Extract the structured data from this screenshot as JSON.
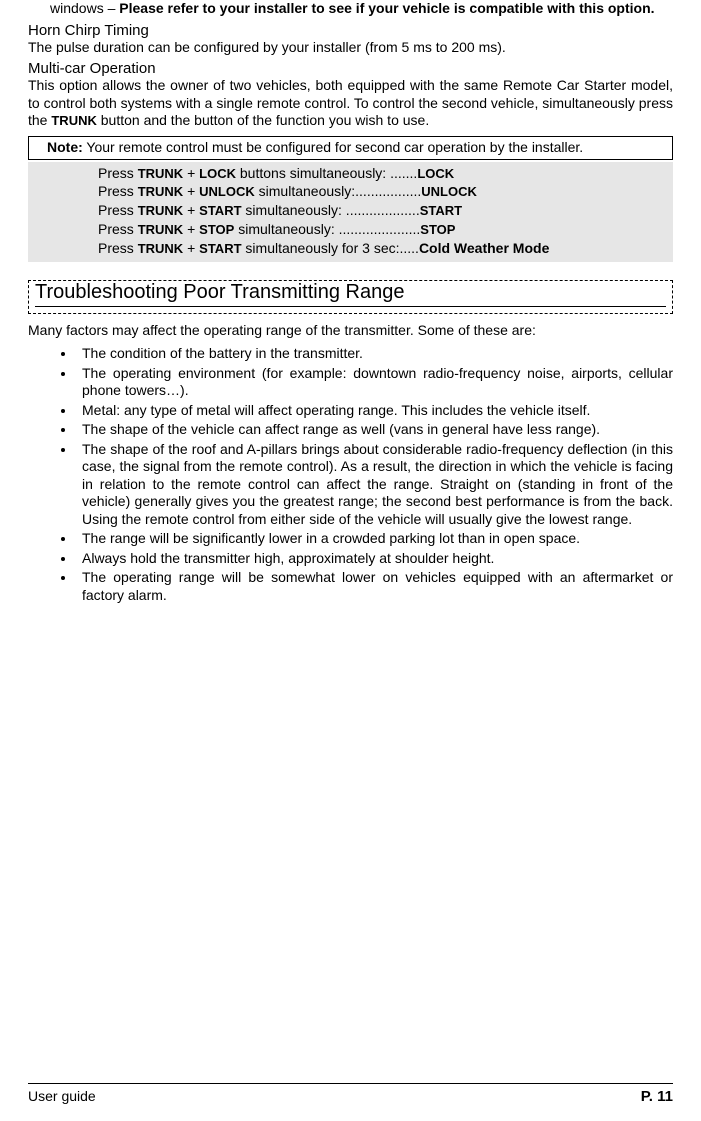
{
  "intro": {
    "windows_pre": "windows – ",
    "windows_bold": "Please refer to your installer to see if your vehicle is compatible with this option."
  },
  "horn": {
    "heading": "Horn Chirp Timing",
    "text": "The pulse duration can be configured by your installer (from 5 ms to 200 ms)."
  },
  "multicar": {
    "heading": "Multi-car Operation",
    "text_a": "This option allows the owner of two vehicles, both equipped with the same Remote Car Starter model, to control both systems with a single remote control. To control the second vehicle, simultaneously press the ",
    "text_trunk": "TRUNK",
    "text_b": " button and the button of the function you wish to use."
  },
  "note": {
    "label": "Note:",
    "text": " Your remote control must be configured for second car operation by the installer."
  },
  "combo": {
    "press": "Press ",
    "trunk": "TRUNK",
    "plus": " + ",
    "lock": "LOCK",
    "unlock": "UNLOCK",
    "start": "START",
    "stop": "STOP",
    "cwm": "Cold Weather Mode",
    "rows": [
      {
        "btn": "LOCK",
        "mid": " buttons simultaneously: .......",
        "result": "LOCK"
      },
      {
        "btn": "UNLOCK",
        "mid": " simultaneously:.................",
        "result": "UNLOCK"
      },
      {
        "btn": "START",
        "mid": " simultaneously: ...................",
        "result": "START"
      },
      {
        "btn": "STOP",
        "mid": " simultaneously: .....................",
        "result": "STOP"
      },
      {
        "btn": "START",
        "mid": " simultaneously for 3 sec:.....",
        "result": "Cold Weather Mode"
      }
    ]
  },
  "troubleshoot": {
    "heading": "Troubleshooting Poor Transmitting Range",
    "intro": "Many factors may affect the operating range of the transmitter.  Some of these are:",
    "bullets": [
      "The condition of the battery in the transmitter.",
      "The operating environment (for example: downtown radio-frequency noise, airports, cellular phone towers…).",
      "Metal: any type of metal will affect operating range. This includes the vehicle itself.",
      "The shape of the vehicle can affect range as well (vans in general have less range).",
      "The shape of the roof and A-pillars brings about considerable radio-frequency deflection (in this case, the signal from the remote control). As a result, the direction in which the vehicle is facing in relation to the remote control can affect the range. Straight on (standing in front of the vehicle) generally gives you the greatest range; the second best performance is from the back. Using the remote control from either side of the vehicle will usually give the lowest range.",
      "The range will be significantly lower in a crowded parking lot than in open space.",
      "Always hold the transmitter high, approximately at shoulder height.",
      "The operating range will be somewhat lower on vehicles equipped with an aftermarket or factory alarm."
    ]
  },
  "footer": {
    "left": "User guide",
    "right": "P. 11"
  }
}
